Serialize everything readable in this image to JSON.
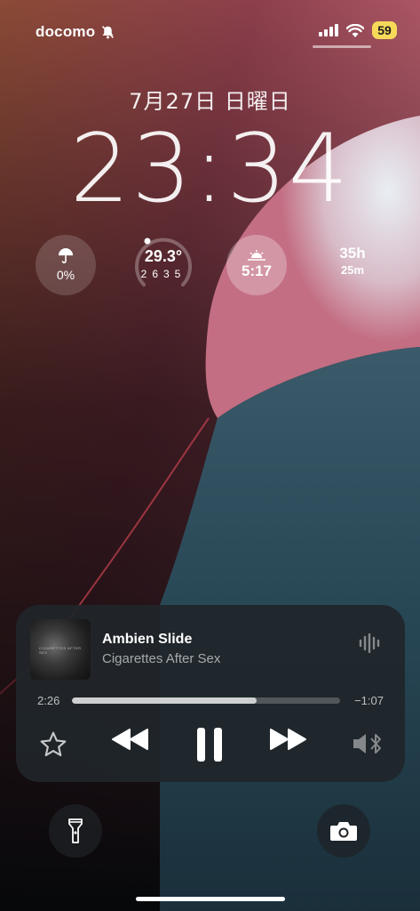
{
  "status_bar": {
    "carrier": "docomo",
    "battery": "59",
    "icons": [
      "bell-slash-icon",
      "cellular-signal-icon",
      "wifi-icon"
    ]
  },
  "lock_screen": {
    "date": "7月27日 日曜日",
    "time": "23:34"
  },
  "widgets": {
    "rain": {
      "icon": "umbrella-icon",
      "value": "0%"
    },
    "temperature": {
      "current": "29.3°",
      "low": "26",
      "high": "35",
      "level": 0.5
    },
    "sunrise": {
      "icon": "sunrise-icon",
      "value": "5:17"
    },
    "countdown": {
      "hours": "35h",
      "minutes": "25m"
    }
  },
  "now_playing": {
    "album_art_text": "CIGARETTES AFTER SEX",
    "title": "Ambien Slide",
    "artist": "Cigarettes After Sex",
    "elapsed": "2:26",
    "remaining": "−1:07",
    "progress": 0.69,
    "icons": [
      "waveform-icon",
      "star-icon",
      "rewind-icon",
      "pause-icon",
      "fast-forward-icon",
      "speaker-bluetooth-icon"
    ]
  },
  "quick_actions": {
    "left": "flashlight-icon",
    "right": "camera-icon"
  },
  "colors": {
    "battery": "#f7d95a",
    "player_bg": "#20262a"
  }
}
